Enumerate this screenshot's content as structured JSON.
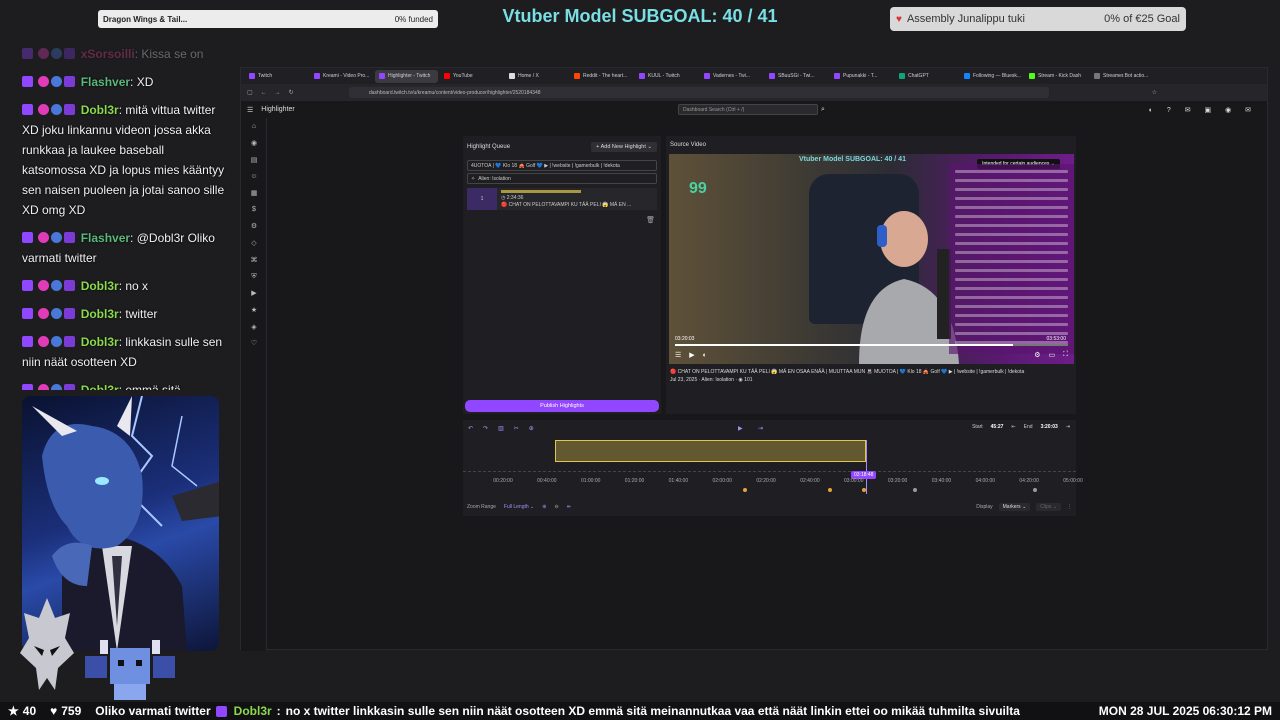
{
  "overlay": {
    "goal_left": {
      "label": "Dragon Wings & Tail...",
      "status": "0% funded",
      "progress": 0
    },
    "subgoal": "Vtuber Model SUBGOAL: 40 / 41",
    "goal_right": {
      "label": "Assembly Junalippu tuki",
      "status": "0% of €25 Goal",
      "progress": 0
    }
  },
  "chat": [
    {
      "name": "xSorsoilli",
      "text": "Kissa se on",
      "name_color": "#e04a8a",
      "faded": true
    },
    {
      "name": "Flashver",
      "text": "XD",
      "name_color": "#5ab87a"
    },
    {
      "name": "Dobl3r",
      "text": "mitä vittua twitter XD joku linkannu videon jossa akka runkkaa ja laukee baseball katsomossa XD ja lopus mies kääntyy sen naisen puoleen ja jotai sanoo sille XD omg XD",
      "name_color": "#8bd94c"
    },
    {
      "name": "Flashver",
      "text": "@Dobl3r Oliko varmati twitter",
      "name_color": "#5ab87a"
    },
    {
      "name": "Dobl3r",
      "text": "no x",
      "name_color": "#8bd94c"
    },
    {
      "name": "Dobl3r",
      "text": "twitter",
      "name_color": "#8bd94c"
    },
    {
      "name": "Dobl3r",
      "text": "linkkasin sulle sen niin näät osotteen XD",
      "name_color": "#8bd94c"
    },
    {
      "name": "Dobl3r",
      "text": "emmä sitä meinannutkaa vaa että näät linkin ettei oo mikää tuhmilta sivuilta",
      "name_color": "#8bd94c"
    }
  ],
  "browser": {
    "tabs": [
      "Twitch",
      "Kreami - Video Pro...",
      "Highlighter - Twitch",
      "YouTube",
      "Home / X",
      "Reddit - The heart...",
      "KUUL - Twitch",
      "Vadernes - Twi...",
      "SBuuSGi - Twi...",
      "Pupunakki - T...",
      "ChatGPT",
      "Following — Bluesk...",
      "Stream - Kick Dash",
      "Streamer.Bot actio..."
    ],
    "active_tab": 2,
    "url": "dashboard.twitch.tv/u/kreamu/content/video-producer/highlighter/2520184348",
    "app_title": "Highlighter",
    "search_placeholder": "Dashboard Search (Ctrl + /)"
  },
  "highlight_queue": {
    "title": "Highlight Queue",
    "add_button": "Add New Highlight",
    "tags_row": "4UOTOA  | 💙 Klo 18 🎪 Golf 💙 ▶  | !website  | !gamerbulk  | !dekota",
    "category": "Alien: Isolation",
    "item_num": "1",
    "item_time": "2:34:36",
    "item_title": "🔴 CHAT ON PELOTTAVAMPI KU TÄÄ PELI 😱 MÄ EN ...",
    "publish_button": "Publish Highlights"
  },
  "source_video": {
    "title": "Source Video",
    "overlay_title": "Vtuber Model SUBGOAL: 40 / 41",
    "audience_pill": "Intended for certain audiences",
    "counter": "99",
    "time_current": "03:20:03",
    "time_total": "03:53:00",
    "progress": 0.86,
    "meta_title": "🔴 CHAT ON PELOTTAVAMPI KU TÄÄ PELI 😱 MÄ EN OSAA ENÄÄ  | MUUTTAA MUN 🚇 MUOTOA  | 💙 Klo 18 🎪 Golf 💙 ▶  | !website  | !gamerbulk  | !dekota",
    "meta_date": "Jul 23, 2025",
    "meta_category": "Alien: Isolation",
    "meta_views": "101"
  },
  "timeline": {
    "start_label": "Start",
    "start_value": "45:27",
    "end_label": "End",
    "end_value": "3:20:03",
    "labels": [
      "00:20:00",
      "00:40:00",
      "01:00:00",
      "01:20:00",
      "01:40:00",
      "02:00:00",
      "02:20:00",
      "02:40:00",
      "03:00:00",
      "03:20:00",
      "03:40:00",
      "04:00:00",
      "04:20:00",
      "05:00:00"
    ],
    "playhead_label": "03:18:48",
    "zoom_range_label": "Zoom Range",
    "zoom_range_value": "Full Length",
    "display_label": "Display",
    "display_value": "Markers",
    "clips_value": "Clips"
  },
  "ticker": {
    "stars": "40",
    "hearts": "759",
    "scroll_user": "Dobl3r",
    "scroll_prefix": "Oliko varmati twitter",
    "scroll_text": "no x  twitter  linkkasin sulle sen niin näät osotteen XD  emmä sitä meinannutkaa vaa että näät linkin ettei oo mikää tuhmilta sivuilta",
    "clock": "MON 28 JUL 2025 06:30:12 PM"
  },
  "colors": {
    "accent": "#9147ff",
    "subgoal": "#79dfe4",
    "selection": "#e3c54a"
  }
}
